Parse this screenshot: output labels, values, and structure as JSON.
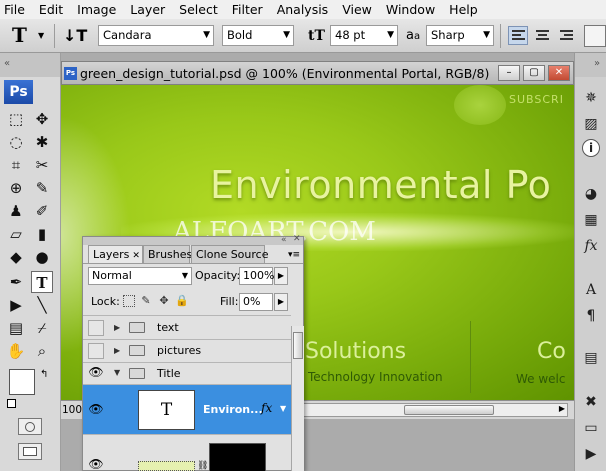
{
  "menubar": {
    "items": [
      "File",
      "Edit",
      "Image",
      "Layer",
      "Select",
      "Filter",
      "Analysis",
      "View",
      "Window",
      "Help"
    ]
  },
  "options": {
    "font_family": "Candara",
    "font_style": "Bold",
    "font_size": "48 pt",
    "antialias": "Sharp",
    "antialias_glyph": "a",
    "antialias_glyph2": "a"
  },
  "document": {
    "title": "green_design_tutorial.psd @ 100% (Environmental Portal, RGB/8)",
    "zoom": "100%",
    "canvas": {
      "heading": "Environmental Po",
      "subscribe": "SUBSCRI",
      "watermark": "ALFOART.COM",
      "solutions": "Solutions",
      "tech_innovation": "Technology Innovation",
      "co": "Co",
      "we_welcome": "We welc"
    }
  },
  "toolbox": {
    "logo": "Ps"
  },
  "layers_panel": {
    "tabs": [
      "Layers",
      "Brushes",
      "Clone Source"
    ],
    "blend_mode": "Normal",
    "opacity_label": "Opacity:",
    "opacity_value": "100%",
    "lock_label": "Lock:",
    "fill_label": "Fill:",
    "fill_value": "0%",
    "layers": [
      {
        "name": "text",
        "visible": false,
        "type": "group",
        "expanded": false
      },
      {
        "name": "pictures",
        "visible": false,
        "type": "group",
        "expanded": false
      },
      {
        "name": "Title",
        "visible": true,
        "type": "group",
        "expanded": true
      },
      {
        "name": "Environ...",
        "visible": true,
        "type": "text",
        "selected": true,
        "thumb": "T",
        "fx": "fx"
      }
    ]
  },
  "colors": {
    "accent_blue": "#3b8fe0",
    "canvas_green": "#8cc016"
  }
}
